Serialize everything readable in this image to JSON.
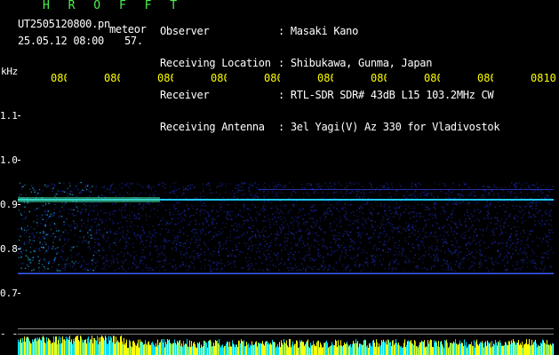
{
  "header": {
    "brand": "H R O F F T",
    "file_name": "UT2505120800.pn",
    "tag": "meteor",
    "datetime": "25.05.12 08:00",
    "count": "57."
  },
  "info": [
    {
      "key": "Observer",
      "value": ": Masaki Kano"
    },
    {
      "key": "Receiving Location",
      "value": ": Shibukawa, Gunma, Japan"
    },
    {
      "key": "Receiver",
      "value": ": RTL-SDR SDR# 43dB L15 103.2MHz CW"
    },
    {
      "key": "Receiving Antenna",
      "value": ": 3el Yagi(V) Az 330 for Vladivostok"
    }
  ],
  "axes": {
    "y_unit": "kHz",
    "y_ticks": [
      "1.1",
      "1.0",
      "0.9",
      "0.8",
      "0.7",
      "0.6"
    ],
    "x_ticks": [
      "080",
      "080",
      "080",
      "080",
      "080",
      "080",
      "080",
      "080",
      "080",
      "0810"
    ]
  },
  "colors": {
    "background": "#000000",
    "signal_low": "#1a2aa8",
    "signal_high": "#20c8ff",
    "peak": "#ffff00",
    "tick_x": "#ffff00",
    "text": "#ffffff",
    "brand": "#4df04d"
  },
  "spectrogram": {
    "carrier_khz": 0.95,
    "secondary_line_khz": 0.785,
    "band_top_khz": 0.99,
    "band_bottom_khz": 0.79
  }
}
